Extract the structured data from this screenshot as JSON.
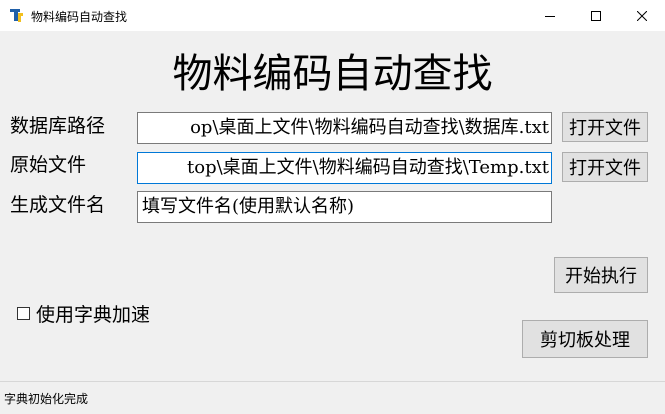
{
  "window": {
    "title": "物料编码自动查找",
    "app_icon": "python-feather-icon",
    "controls": [
      "minimize-icon",
      "maximize-icon",
      "close-icon"
    ]
  },
  "main": {
    "heading": "物料编码自动查找",
    "database": {
      "label": "数据库路径",
      "value": "op\\桌面上文件\\物料编码自动查找\\数据库.txt",
      "button": "打开文件"
    },
    "source": {
      "label": "原始文件",
      "value": "top\\桌面上文件\\物料编码自动查找\\Temp.txt",
      "button": "打开文件"
    },
    "output": {
      "label": "生成文件名",
      "placeholder": "填写文件名(使用默认名称)"
    },
    "run_button": "开始执行",
    "dictionary_checkbox": {
      "label": "使用字典加速",
      "checked": false
    },
    "clipboard_button": "剪切板处理"
  },
  "status": {
    "text": "字典初始化完成"
  },
  "colors": {
    "background": "#f0f0f0",
    "focus_border": "#0078d7"
  }
}
